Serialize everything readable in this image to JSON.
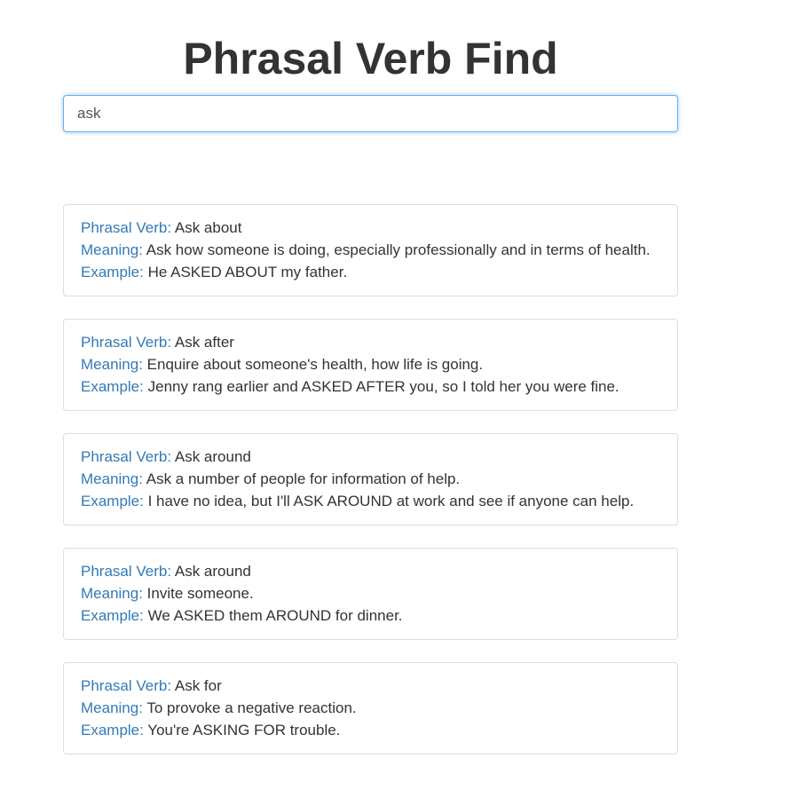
{
  "header": {
    "title": "Phrasal Verb Find"
  },
  "search": {
    "value": "ask"
  },
  "labels": {
    "phrasal_verb": "Phrasal Verb:",
    "meaning": "Meaning:",
    "example": "Example:"
  },
  "results": [
    {
      "phrasal_verb": "Ask about",
      "meaning": "Ask how someone is doing, especially professionally and in terms of health.",
      "example": "He ASKED ABOUT my father."
    },
    {
      "phrasal_verb": "Ask after",
      "meaning": "Enquire about someone's health, how life is going.",
      "example": "Jenny rang earlier and ASKED AFTER you, so I told her you were fine."
    },
    {
      "phrasal_verb": "Ask around",
      "meaning": "Ask a number of people for information of help.",
      "example": "I have no idea, but I'll ASK AROUND at work and see if anyone can help."
    },
    {
      "phrasal_verb": "Ask around",
      "meaning": "Invite someone.",
      "example": "We ASKED them AROUND for dinner."
    },
    {
      "phrasal_verb": "Ask for",
      "meaning": "To provoke a negative reaction.",
      "example": "You're ASKING FOR trouble."
    }
  ],
  "colors": {
    "label": "#337ab7",
    "text": "#333333",
    "focus_border": "#66afe9",
    "card_border": "#dddddd"
  }
}
